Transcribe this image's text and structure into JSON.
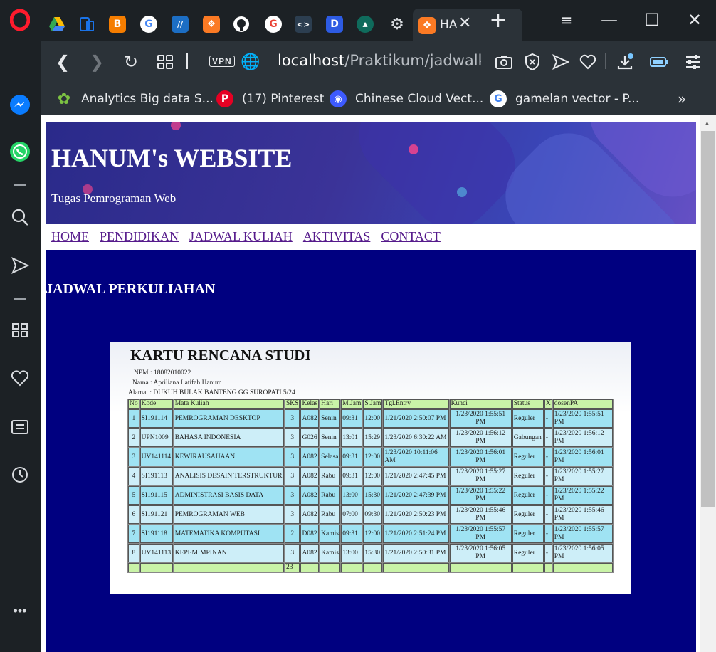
{
  "browser": {
    "active_tab_title": "HA",
    "url_host": "localhost",
    "url_path": "/Praktikum/jadwalkuliah",
    "vpn_label": "VPN",
    "bookmarks": [
      {
        "label": "Analytics Big data S...",
        "icon": "leaf-icon"
      },
      {
        "label": "(17) Pinterest",
        "icon": "pinterest-icon"
      },
      {
        "label": "Chinese Cloud Vect...",
        "icon": "robot-icon"
      },
      {
        "label": "gamelan vector - P...",
        "icon": "google-icon"
      }
    ],
    "more_label": "»"
  },
  "site": {
    "title": "HANUM's WEBSITE",
    "subtitle": "Tugas Pemrograman Web",
    "nav": [
      "HOME",
      "PENDIDIKAN",
      "JADWAL KULIAH",
      "AKTIVITAS",
      "CONTACT"
    ],
    "heading": "JADWAL PERKULIAHAN"
  },
  "krs": {
    "title": "KARTU RENCANA STUDI",
    "npm": "NPM : 18082010022",
    "nama": "Nama : Apriliana Latifah Hanum",
    "alamat": "Alamat : DUKUH BULAK BANTENG GG SUROPATI 5/24",
    "headers": [
      "No",
      "Kode",
      "Mata Kuliah",
      "SKS",
      "Kelas",
      "Hari",
      "M.Jam",
      "S.Jam",
      "Tgl.Entry",
      "Kunci",
      "Status",
      "X",
      "dosenPA"
    ],
    "rows": [
      [
        "1",
        "SI191114",
        "PEMROGRAMAN DESKTOP",
        "3",
        "A082",
        "Senin",
        "09:31",
        "12:00",
        "1/21/2020 2:50:07 PM",
        "1/23/2020 1:55:51 PM",
        "Reguler",
        "-",
        "1/23/2020 1:55:51 PM"
      ],
      [
        "2",
        "UPN1009",
        "BAHASA INDONESIA",
        "3",
        "G026",
        "Senin",
        "13:01",
        "15:29",
        "1/23/2020 6:30:22 AM",
        "1/23/2020 1:56:12 PM",
        "Gabungan",
        "-",
        "1/23/2020 1:56:12 PM"
      ],
      [
        "3",
        "UV141114",
        "KEWIRAUSAHAAN",
        "3",
        "A082",
        "Selasa",
        "09:31",
        "12:00",
        "1/23/2020 10:11:06 AM",
        "1/23/2020 1:56:01 PM",
        "Reguler",
        "-",
        "1/23/2020 1:56:01 PM"
      ],
      [
        "4",
        "SI191113",
        "ANALISIS DESAIN TERSTRUKTUR",
        "3",
        "A082",
        "Rabu",
        "09:31",
        "12:00",
        "1/21/2020 2:47:45 PM",
        "1/23/2020 1:55:27 PM",
        "Reguler",
        "-",
        "1/23/2020 1:55:27 PM"
      ],
      [
        "5",
        "SI191115",
        "ADMINISTRASI BASIS DATA",
        "3",
        "A082",
        "Rabu",
        "13:00",
        "15:30",
        "1/21/2020 2:47:39 PM",
        "1/23/2020 1:55:22 PM",
        "Reguler",
        "-",
        "1/23/2020 1:55:22 PM"
      ],
      [
        "6",
        "SI191121",
        "PEMROGRAMAN WEB",
        "3",
        "A082",
        "Rabu",
        "07:00",
        "09:30",
        "1/21/2020 2:50:23 PM",
        "1/23/2020 1:55:46 PM",
        "Reguler",
        "-",
        "1/23/2020 1:55:46 PM"
      ],
      [
        "7",
        "SI191118",
        "MATEMATIKA KOMPUTASI",
        "2",
        "D082",
        "Kamis",
        "09:31",
        "12:00",
        "1/21/2020 2:51:24 PM",
        "1/23/2020 1:55:57 PM",
        "Reguler",
        "-",
        "1/23/2020 1:55:57 PM"
      ],
      [
        "8",
        "UV141113",
        "KEPEMIMPINAN",
        "3",
        "A082",
        "Kamis",
        "13:00",
        "15:30",
        "1/21/2020 2:50:31 PM",
        "1/23/2020 1:56:05 PM",
        "Reguler",
        "-",
        "1/23/2020 1:56:05 PM"
      ]
    ],
    "total_sks": "23"
  }
}
